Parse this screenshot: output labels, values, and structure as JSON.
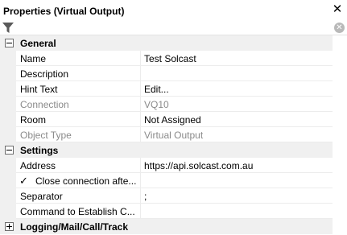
{
  "panel": {
    "title": "Properties (Virtual Output)",
    "close_symbol": "✕",
    "filter_icon": "filter-icon",
    "clear_symbol": "✕",
    "filter_placeholder": ""
  },
  "categories": [
    {
      "label": "General",
      "expanded": true,
      "rows": [
        {
          "name": "Name",
          "value": "Test Solcast",
          "disabled": false
        },
        {
          "name": "Description",
          "value": "",
          "disabled": false
        },
        {
          "name": "Hint Text",
          "value": "Edit...",
          "disabled": false
        },
        {
          "name": "Connection",
          "value": "VQ10",
          "disabled": true
        },
        {
          "name": "Room",
          "value": "Not Assigned",
          "disabled": false
        },
        {
          "name": "Object Type",
          "value": "Virtual Output",
          "disabled": true
        }
      ]
    },
    {
      "label": "Settings",
      "expanded": true,
      "rows": [
        {
          "name": "Address",
          "value": "https://api.solcast.com.au",
          "disabled": false
        },
        {
          "name": "Close connection afte...",
          "value": "",
          "disabled": false,
          "checkbox": true,
          "checked": true,
          "check_symbol": "✓"
        },
        {
          "name": "Separator",
          "value": ";",
          "disabled": false
        },
        {
          "name": "Command to Establish C...",
          "value": "",
          "disabled": false
        }
      ]
    },
    {
      "label": "Logging/Mail/Call/Track",
      "expanded": false,
      "rows": []
    }
  ]
}
